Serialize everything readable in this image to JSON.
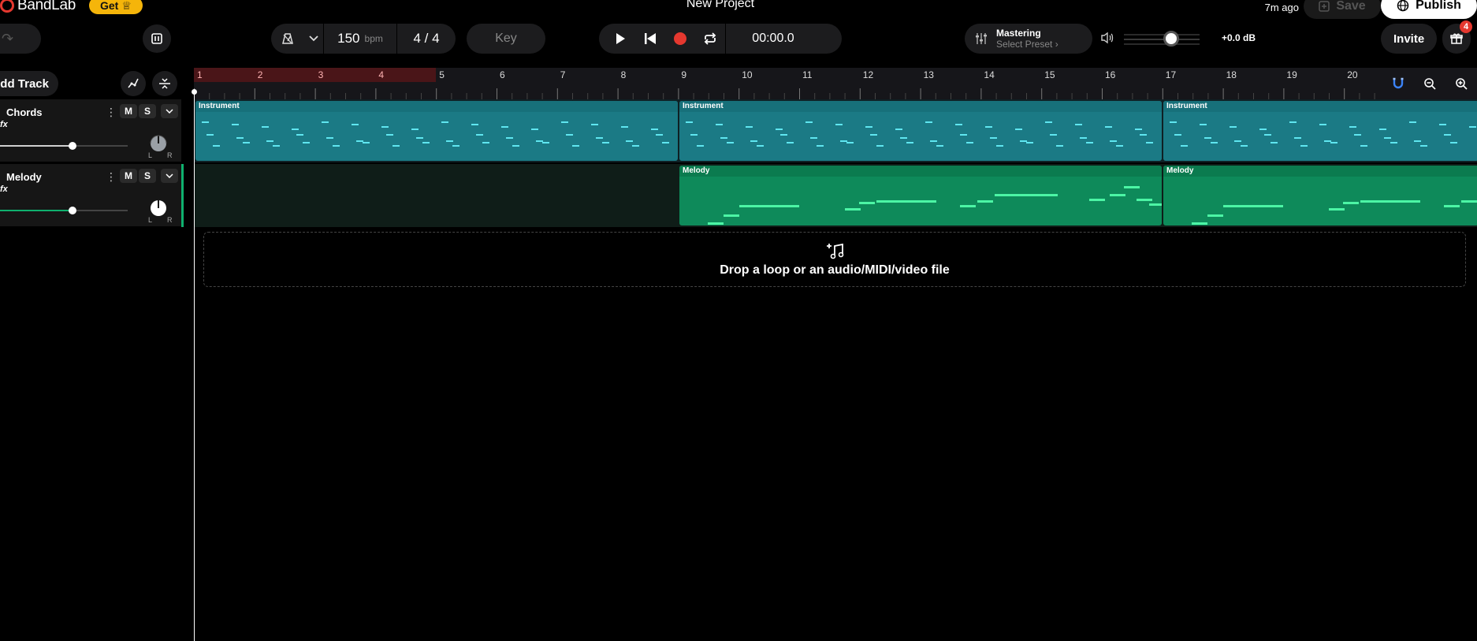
{
  "app": {
    "brand": "BandLab",
    "get_label": "Get",
    "project_title": "New Project",
    "saved_ago": "7m ago",
    "save_label": "Save",
    "publish_label": "Publish"
  },
  "toolbar": {
    "bpm": "150",
    "bpm_unit": "bpm",
    "time_signature": "4 / 4",
    "key_label": "Key",
    "time": "00:00.0",
    "mastering_title": "Mastering",
    "mastering_preset": "Select Preset",
    "master_db": "+0.0 dB",
    "master_volume": 0.62,
    "invite_label": "Invite",
    "gift_badge": "4"
  },
  "panel": {
    "add_track_label": "Add Track"
  },
  "tracks": [
    {
      "name": "Chords",
      "fx": "fx",
      "mute": "M",
      "solo": "S",
      "volume": 0.57,
      "color": "#1b7a85"
    },
    {
      "name": "Melody",
      "fx": "fx",
      "mute": "M",
      "solo": "S",
      "volume": 0.57,
      "color": "#0fb06e"
    }
  ],
  "ruler": {
    "bars": [
      "1",
      "2",
      "3",
      "4",
      "5",
      "6",
      "7",
      "8",
      "9",
      "10",
      "11",
      "12",
      "13",
      "14",
      "15",
      "16",
      "17",
      "18",
      "19",
      "20"
    ],
    "loop_bars": 4
  },
  "clips": {
    "chords": [
      "Instrument",
      "Instrument",
      "Instrument"
    ],
    "melody": [
      "Melody",
      "Melody"
    ]
  },
  "drop_zone": {
    "text": "Drop a loop or an audio/MIDI/video file"
  },
  "colors": {
    "accent_record": "#e5382f",
    "brand_yellow": "#f5b50a",
    "chords_clip": "#1b7a85",
    "melody_clip": "#0e8a5a"
  }
}
